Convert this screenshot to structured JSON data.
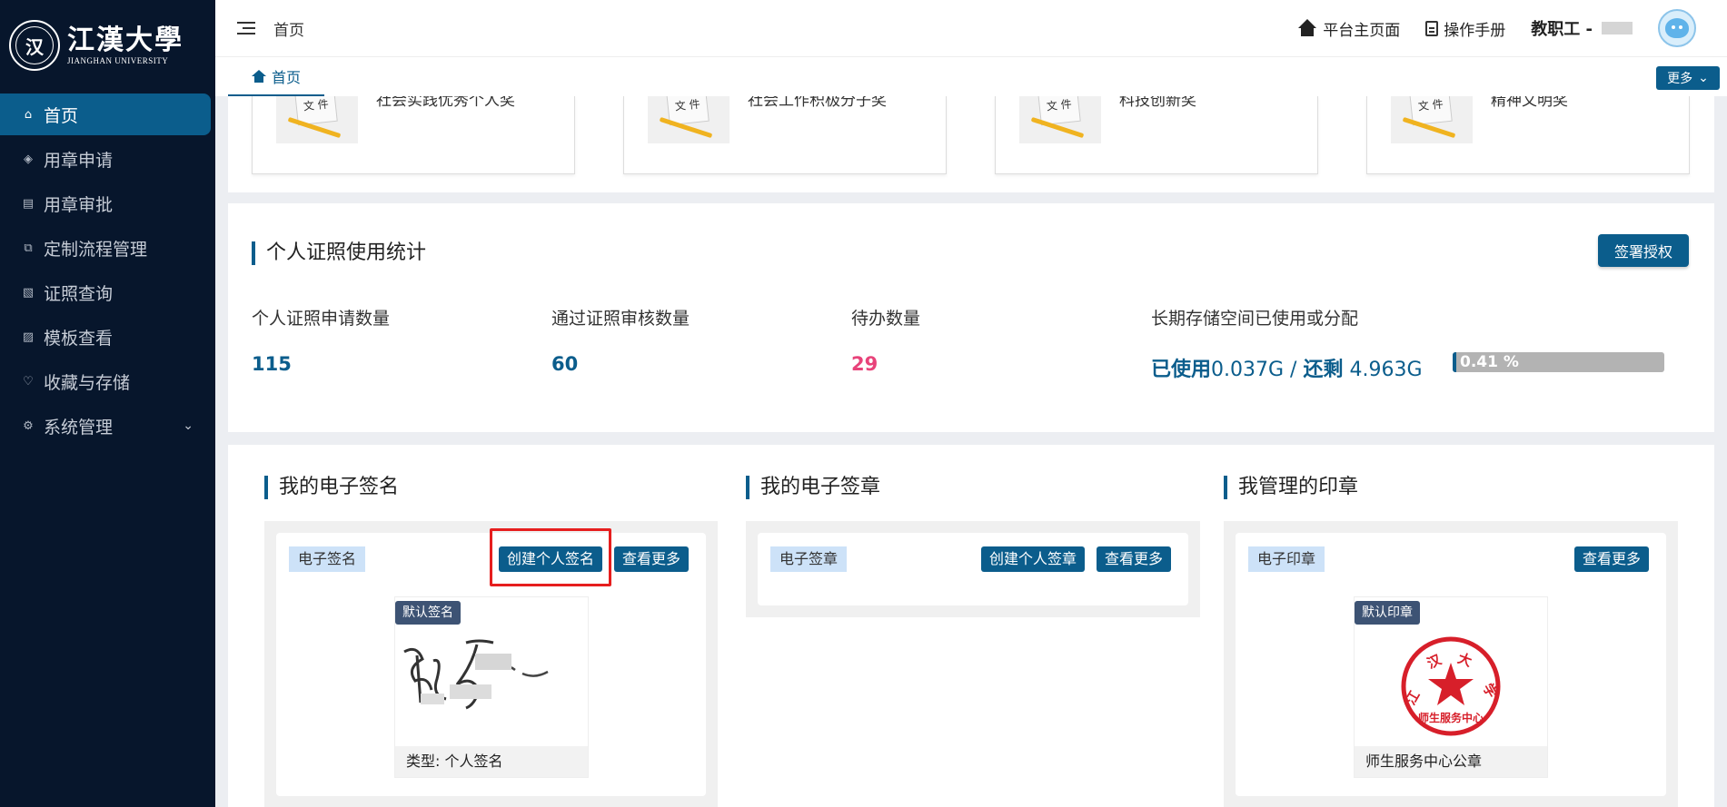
{
  "sidebar": {
    "logo_cn": "江漢大學",
    "logo_en": "JIANGHAN UNIVERSITY",
    "items": [
      {
        "label": "首页",
        "icon": "home-icon",
        "active": true
      },
      {
        "label": "用章申请",
        "icon": "stamp-apply-icon"
      },
      {
        "label": "用章审批",
        "icon": "approval-icon"
      },
      {
        "label": "定制流程管理",
        "icon": "flow-icon"
      },
      {
        "label": "证照查询",
        "icon": "document-search-icon"
      },
      {
        "label": "模板查看",
        "icon": "template-icon"
      },
      {
        "label": "收藏与存储",
        "icon": "heart-icon"
      },
      {
        "label": "系统管理",
        "icon": "gear-icon",
        "has_submenu": true
      }
    ]
  },
  "header": {
    "breadcrumb": "首页",
    "platform_home": "平台主页面",
    "manual": "操作手册",
    "user_role": "教职工 -"
  },
  "tabbar": {
    "tab_label": "首页",
    "more_label": "更多"
  },
  "awards": [
    {
      "title": "社会实践优秀个人奖"
    },
    {
      "title": "社会工作积极分子奖"
    },
    {
      "title": "科技创新奖"
    },
    {
      "title": "精神文明奖"
    }
  ],
  "award_img_label": "文 件",
  "stats": {
    "title": "个人证照使用统计",
    "sign_auth_label": "签署授权",
    "apply_label": "个人证照申请数量",
    "apply_value": "115",
    "passed_label": "通过证照审核数量",
    "passed_value": "60",
    "todo_label": "待办数量",
    "todo_value": "29",
    "storage_label": "长期存储空间已使用或分配",
    "storage_used_prefix": "已使用",
    "storage_used": "0.037G",
    "storage_sep": " / ",
    "storage_left_prefix": "还剩",
    "storage_left": " 4.963G",
    "storage_percent": "0.41 %",
    "storage_fraction": 0.0041
  },
  "signature": {
    "title": "我的电子签名",
    "tag": "电子签名",
    "create_label": "创建个人签名",
    "more_label": "查看更多",
    "badge": "默认签名",
    "caption": "类型: 个人签名"
  },
  "eseal": {
    "title": "我的电子签章",
    "tag": "电子签章",
    "create_label": "创建个人签章",
    "more_label": "查看更多"
  },
  "managed_seal": {
    "title": "我管理的印章",
    "tag": "电子印章",
    "more_label": "查看更多",
    "badge": "默认印章",
    "caption": "师生服务中心公章",
    "seal_chars": [
      "江",
      "汉",
      "大",
      "学"
    ],
    "seal_center": "师生服务中心"
  },
  "colors": {
    "primary": "#0b5d8c",
    "sidebar_bg": "#07162c",
    "pink": "#e8437a",
    "highlight": "#e61e1e",
    "seal_red": "#d71f2a"
  }
}
